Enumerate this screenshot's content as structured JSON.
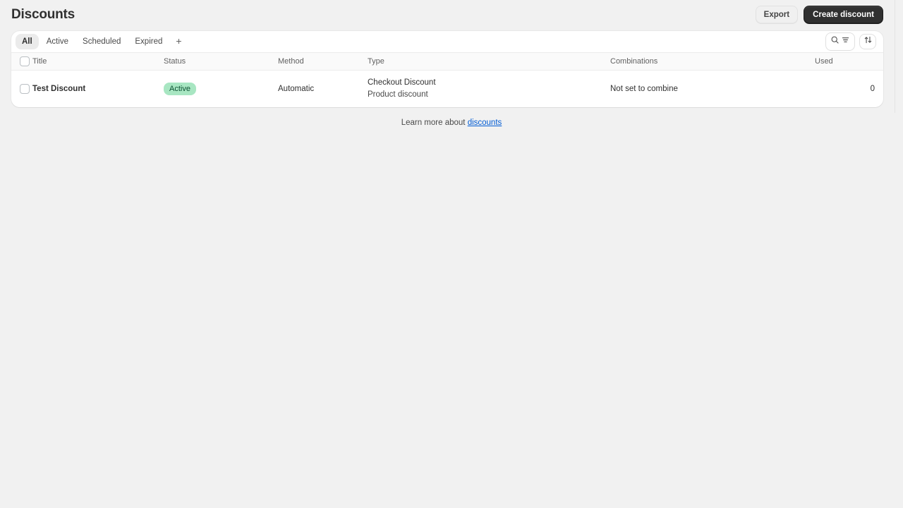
{
  "header": {
    "title": "Discounts",
    "export_label": "Export",
    "create_label": "Create discount"
  },
  "tabbar": {
    "tabs": [
      {
        "label": "All",
        "selected": true
      },
      {
        "label": "Active",
        "selected": false
      },
      {
        "label": "Scheduled",
        "selected": false
      },
      {
        "label": "Expired",
        "selected": false
      }
    ],
    "add_tab_label": "+",
    "search_icon": "search-icon",
    "filter_icon": "filter-icon",
    "sort_icon": "sort-icon"
  },
  "table": {
    "columns": [
      "Title",
      "Status",
      "Method",
      "Type",
      "Combinations",
      "Used"
    ],
    "rows": [
      {
        "title": "Test Discount",
        "status": "Active",
        "method": "Automatic",
        "type_primary": "Checkout Discount",
        "type_secondary": "Product discount",
        "combinations": "Not set to combine",
        "used": "0"
      }
    ]
  },
  "footer": {
    "text_before": "Learn more about ",
    "link_text": "discounts"
  },
  "colors": {
    "page_bg": "#f1f1f1",
    "card_bg": "#ffffff",
    "primary_button": "#303030",
    "badge_success_bg": "#a8e6c2",
    "badge_success_text": "#0c5132",
    "link": "#005bd3"
  }
}
